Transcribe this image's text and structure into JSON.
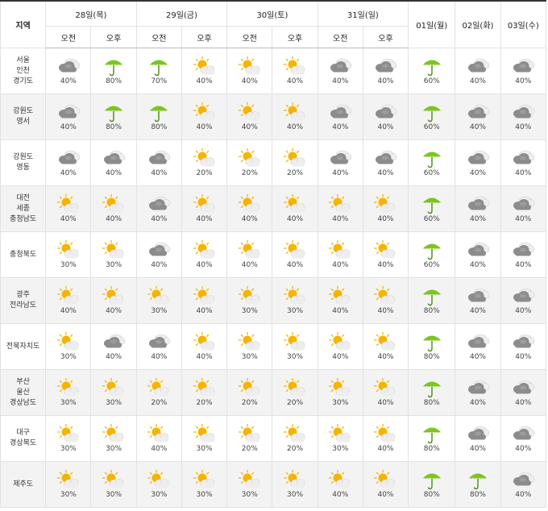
{
  "header": {
    "region_label": "지역",
    "days": [
      {
        "date": "28일(목)",
        "am": "오전",
        "pm": "오후"
      },
      {
        "date": "29일(금)",
        "am": "오전",
        "pm": "오후"
      },
      {
        "date": "30일(토)",
        "am": "오전",
        "pm": "오후"
      },
      {
        "date": "31일(일)",
        "am": "오전",
        "pm": "오후"
      }
    ],
    "later_days": [
      "01일(월)",
      "02일(화)",
      "03일(수)"
    ]
  },
  "icon_names": {
    "c": "cloudy-icon",
    "r": "rain-umbrella-icon",
    "p": "partly-cloudy-icon"
  },
  "rows": [
    {
      "region": [
        "서울",
        "인천",
        "경기도"
      ],
      "shade": false,
      "cells": [
        {
          "icon": "c",
          "pct": "40%"
        },
        {
          "icon": "r",
          "pct": "80%"
        },
        {
          "icon": "r",
          "pct": "70%"
        },
        {
          "icon": "p",
          "pct": "40%"
        },
        {
          "icon": "p",
          "pct": "40%"
        },
        {
          "icon": "p",
          "pct": "40%"
        },
        {
          "icon": "c",
          "pct": "40%"
        },
        {
          "icon": "c",
          "pct": "40%"
        },
        {
          "icon": "r",
          "pct": "60%"
        },
        {
          "icon": "c",
          "pct": "40%"
        },
        {
          "icon": "c",
          "pct": "40%"
        }
      ]
    },
    {
      "region": [
        "강원도",
        "영서"
      ],
      "shade": true,
      "cells": [
        {
          "icon": "c",
          "pct": "40%"
        },
        {
          "icon": "r",
          "pct": "80%"
        },
        {
          "icon": "r",
          "pct": "80%"
        },
        {
          "icon": "p",
          "pct": "40%"
        },
        {
          "icon": "p",
          "pct": "40%"
        },
        {
          "icon": "p",
          "pct": "40%"
        },
        {
          "icon": "c",
          "pct": "40%"
        },
        {
          "icon": "c",
          "pct": "40%"
        },
        {
          "icon": "r",
          "pct": "60%"
        },
        {
          "icon": "c",
          "pct": "40%"
        },
        {
          "icon": "c",
          "pct": "40%"
        }
      ]
    },
    {
      "region": [
        "강원도",
        "영동"
      ],
      "shade": false,
      "cells": [
        {
          "icon": "c",
          "pct": "40%"
        },
        {
          "icon": "c",
          "pct": "40%"
        },
        {
          "icon": "c",
          "pct": "40%"
        },
        {
          "icon": "p",
          "pct": "20%"
        },
        {
          "icon": "p",
          "pct": "20%"
        },
        {
          "icon": "p",
          "pct": "20%"
        },
        {
          "icon": "c",
          "pct": "40%"
        },
        {
          "icon": "c",
          "pct": "40%"
        },
        {
          "icon": "r",
          "pct": "60%"
        },
        {
          "icon": "c",
          "pct": "40%"
        },
        {
          "icon": "c",
          "pct": "40%"
        }
      ]
    },
    {
      "region": [
        "대전",
        "세종",
        "충청남도"
      ],
      "shade": true,
      "cells": [
        {
          "icon": "p",
          "pct": "40%"
        },
        {
          "icon": "p",
          "pct": "40%"
        },
        {
          "icon": "c",
          "pct": "40%"
        },
        {
          "icon": "p",
          "pct": "40%"
        },
        {
          "icon": "p",
          "pct": "40%"
        },
        {
          "icon": "p",
          "pct": "40%"
        },
        {
          "icon": "p",
          "pct": "40%"
        },
        {
          "icon": "p",
          "pct": "40%"
        },
        {
          "icon": "r",
          "pct": "60%"
        },
        {
          "icon": "c",
          "pct": "40%"
        },
        {
          "icon": "c",
          "pct": "40%"
        }
      ]
    },
    {
      "region": [
        "충청북도"
      ],
      "shade": false,
      "cells": [
        {
          "icon": "p",
          "pct": "30%"
        },
        {
          "icon": "p",
          "pct": "30%"
        },
        {
          "icon": "c",
          "pct": "40%"
        },
        {
          "icon": "p",
          "pct": "40%"
        },
        {
          "icon": "p",
          "pct": "40%"
        },
        {
          "icon": "p",
          "pct": "40%"
        },
        {
          "icon": "p",
          "pct": "40%"
        },
        {
          "icon": "p",
          "pct": "40%"
        },
        {
          "icon": "r",
          "pct": "60%"
        },
        {
          "icon": "c",
          "pct": "40%"
        },
        {
          "icon": "c",
          "pct": "40%"
        }
      ]
    },
    {
      "region": [
        "광주",
        "전라남도"
      ],
      "shade": true,
      "cells": [
        {
          "icon": "p",
          "pct": "40%"
        },
        {
          "icon": "p",
          "pct": "40%"
        },
        {
          "icon": "p",
          "pct": "30%"
        },
        {
          "icon": "p",
          "pct": "40%"
        },
        {
          "icon": "p",
          "pct": "30%"
        },
        {
          "icon": "p",
          "pct": "30%"
        },
        {
          "icon": "p",
          "pct": "40%"
        },
        {
          "icon": "p",
          "pct": "40%"
        },
        {
          "icon": "r",
          "pct": "80%"
        },
        {
          "icon": "c",
          "pct": "40%"
        },
        {
          "icon": "c",
          "pct": "40%"
        }
      ]
    },
    {
      "region": [
        "전북자치도"
      ],
      "shade": false,
      "cells": [
        {
          "icon": "p",
          "pct": "30%"
        },
        {
          "icon": "c",
          "pct": "40%"
        },
        {
          "icon": "c",
          "pct": "40%"
        },
        {
          "icon": "p",
          "pct": "40%"
        },
        {
          "icon": "p",
          "pct": "30%"
        },
        {
          "icon": "p",
          "pct": "30%"
        },
        {
          "icon": "p",
          "pct": "40%"
        },
        {
          "icon": "p",
          "pct": "40%"
        },
        {
          "icon": "r",
          "pct": "80%"
        },
        {
          "icon": "c",
          "pct": "40%"
        },
        {
          "icon": "c",
          "pct": "40%"
        }
      ]
    },
    {
      "region": [
        "부산",
        "울산",
        "경상남도"
      ],
      "shade": true,
      "cells": [
        {
          "icon": "p",
          "pct": "30%"
        },
        {
          "icon": "p",
          "pct": "30%"
        },
        {
          "icon": "p",
          "pct": "20%"
        },
        {
          "icon": "p",
          "pct": "20%"
        },
        {
          "icon": "p",
          "pct": "20%"
        },
        {
          "icon": "p",
          "pct": "20%"
        },
        {
          "icon": "p",
          "pct": "30%"
        },
        {
          "icon": "p",
          "pct": "40%"
        },
        {
          "icon": "r",
          "pct": "80%"
        },
        {
          "icon": "c",
          "pct": "40%"
        },
        {
          "icon": "c",
          "pct": "40%"
        }
      ]
    },
    {
      "region": [
        "대구",
        "경상북도"
      ],
      "shade": false,
      "cells": [
        {
          "icon": "p",
          "pct": "30%"
        },
        {
          "icon": "p",
          "pct": "30%"
        },
        {
          "icon": "p",
          "pct": "40%"
        },
        {
          "icon": "p",
          "pct": "30%"
        },
        {
          "icon": "p",
          "pct": "20%"
        },
        {
          "icon": "p",
          "pct": "20%"
        },
        {
          "icon": "p",
          "pct": "30%"
        },
        {
          "icon": "p",
          "pct": "40%"
        },
        {
          "icon": "r",
          "pct": "80%"
        },
        {
          "icon": "c",
          "pct": "40%"
        },
        {
          "icon": "c",
          "pct": "40%"
        }
      ]
    },
    {
      "region": [
        "제주도"
      ],
      "shade": true,
      "cells": [
        {
          "icon": "p",
          "pct": "30%"
        },
        {
          "icon": "p",
          "pct": "30%"
        },
        {
          "icon": "p",
          "pct": "30%"
        },
        {
          "icon": "p",
          "pct": "30%"
        },
        {
          "icon": "p",
          "pct": "30%"
        },
        {
          "icon": "p",
          "pct": "30%"
        },
        {
          "icon": "p",
          "pct": "40%"
        },
        {
          "icon": "p",
          "pct": "40%"
        },
        {
          "icon": "r",
          "pct": "80%"
        },
        {
          "icon": "r",
          "pct": "80%"
        },
        {
          "icon": "c",
          "pct": "40%"
        }
      ]
    }
  ],
  "colors": {
    "umbrella": "#7cc61d",
    "sun": "#f5b400",
    "cloud_light": "#eeeeee",
    "cloud_dark": "#8c8c8c"
  }
}
